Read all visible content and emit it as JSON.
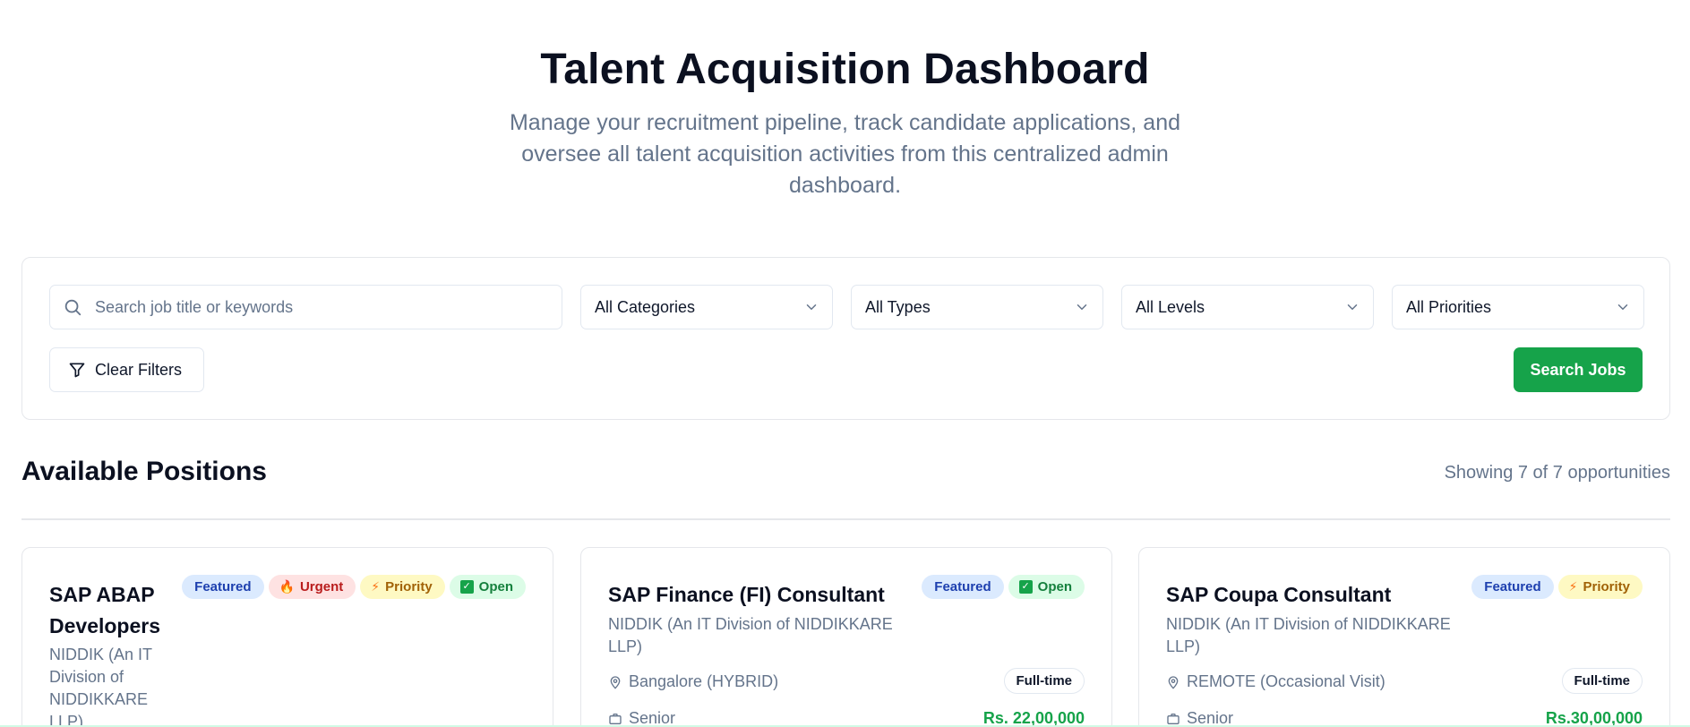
{
  "hero": {
    "title": "Talent Acquisition Dashboard",
    "subtitle": "Manage your recruitment pipeline, track candidate applications, and oversee all talent acquisition activities from this centralized admin dashboard."
  },
  "filters": {
    "search_placeholder": "Search job title or keywords",
    "category": "All Categories",
    "type": "All Types",
    "level": "All Levels",
    "priority": "All Priorities",
    "clear_label": "Clear Filters",
    "search_label": "Search Jobs"
  },
  "positions": {
    "heading": "Available Positions",
    "count_text": "Showing 7 of 7 opportunities"
  },
  "jobs": [
    {
      "title": "SAP ABAP Developers",
      "company": "NIDDIK (An IT Division of NIDDIKKARE LLP)",
      "badges": {
        "featured": "Featured",
        "urgent": "Urgent",
        "priority": "Priority",
        "open": "Open"
      }
    },
    {
      "title": "SAP Finance (FI) Consultant",
      "company": "NIDDIK (An IT Division of NIDDIKKARE LLP)",
      "badges": {
        "featured": "Featured",
        "open": "Open"
      },
      "location": "Bangalore (HYBRID)",
      "job_type": "Full-time",
      "level": "Senior",
      "salary": "Rs. 22,00,000"
    },
    {
      "title": "SAP Coupa Consultant",
      "company": "NIDDIK (An IT Division of NIDDIKKARE LLP)",
      "badges": {
        "featured": "Featured",
        "priority": "Priority"
      },
      "location": "REMOTE (Occasional Visit)",
      "job_type": "Full-time",
      "level": "Senior",
      "salary": "Rs.30,00,000"
    }
  ],
  "colors": {
    "accent_green": "#16a34a",
    "featured_bg": "#dbeafe",
    "urgent_bg": "#fee2e2",
    "priority_bg": "#fef9c3",
    "open_bg": "#dcfce7"
  }
}
